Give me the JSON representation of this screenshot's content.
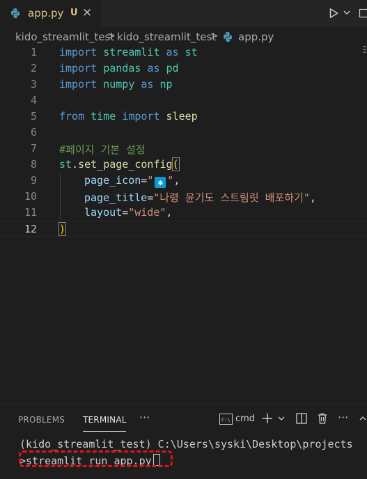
{
  "tab": {
    "filename": "app.py",
    "modified_badge": "U",
    "close_glyph": "×",
    "filename_color": "#e2c08d"
  },
  "toolbar": {
    "run_icon": "play-icon",
    "chevron_icon": "chevron-down-icon",
    "split_icon": "split-editor-icon"
  },
  "breadcrumb": {
    "items": [
      "kido_streamlit_test",
      "kido_streamlit_test",
      "app.py"
    ],
    "separator": ">"
  },
  "editor": {
    "line_numbers": [
      "1",
      "2",
      "3",
      "4",
      "5",
      "6",
      "7",
      "8",
      "9",
      "10",
      "11",
      "12"
    ],
    "current_line": "12",
    "tokens": {
      "l1": [
        "import",
        " streamlit ",
        "as",
        " st"
      ],
      "l2": [
        "import",
        " pandas ",
        "as",
        " pd"
      ],
      "l3": [
        "import",
        " numpy ",
        "as",
        " np"
      ],
      "l5": [
        "from",
        " time ",
        "import",
        " sleep"
      ],
      "l7": "#페이지 기본 설정",
      "l8": [
        "st",
        ".",
        "set_page_config",
        "("
      ],
      "l9": [
        "page_icon",
        "=",
        "\"",
        "✱",
        "\"",
        ","
      ],
      "l10": [
        "page_title",
        "=",
        "\"나령 윤기도 스트림릿 배포하기\"",
        ","
      ],
      "l11": [
        "layout",
        "=",
        "\"wide\"",
        ","
      ],
      "l12": ")"
    }
  },
  "panel": {
    "tabs": [
      "PROBLEMS",
      "TERMINAL"
    ],
    "active_tab": "TERMINAL",
    "more": "···",
    "terminal_name": "cmd",
    "add": "+",
    "terminal_lines": [
      "(kido_streamlit_test) C:\\Users\\syski\\Desktop\\projects",
      ">streamlit run app.py"
    ]
  },
  "colors": {
    "keyword": "#569cd6",
    "module": "#4ec9b0",
    "function": "#dcdcaa",
    "string": "#ce9178",
    "parameter": "#9cdcfe",
    "comment": "#6a9955",
    "annotation": "#e01515"
  }
}
